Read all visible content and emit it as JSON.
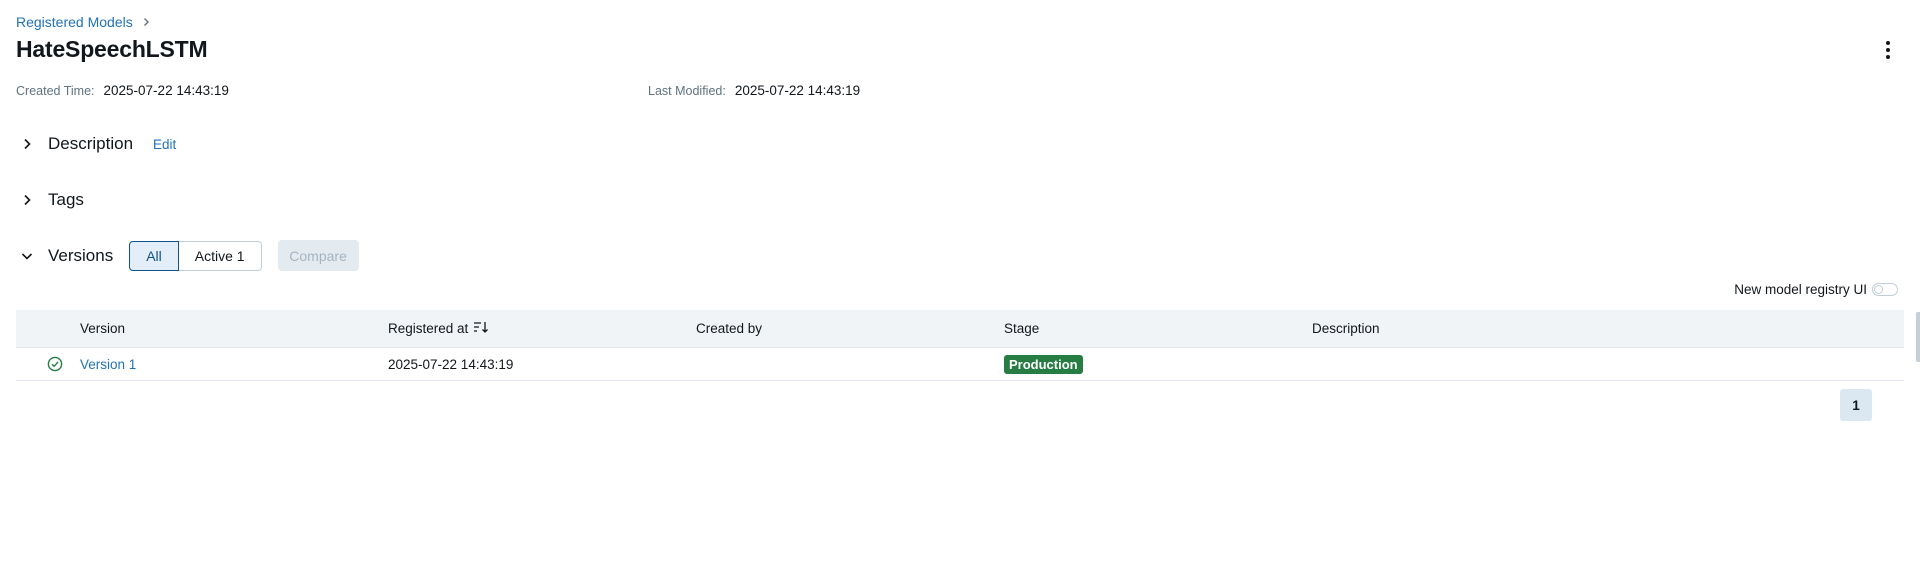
{
  "breadcrumb": {
    "parent_label": "Registered Models",
    "separator_icon": "chevron-right-icon"
  },
  "model": {
    "name": "HateSpeechLSTM"
  },
  "meta": {
    "created_label": "Created Time:",
    "created_value": "2025-07-22 14:43:19",
    "modified_label": "Last Modified:",
    "modified_value": "2025-07-22 14:43:19"
  },
  "sections": {
    "description": {
      "title": "Description",
      "edit_label": "Edit",
      "expanded": false
    },
    "tags": {
      "title": "Tags",
      "expanded": false
    },
    "versions": {
      "title": "Versions",
      "expanded": true,
      "filter_all": "All",
      "filter_active": "Active 1",
      "selected_filter": "All",
      "compare_label": "Compare"
    }
  },
  "toggle": {
    "label": "New model registry UI",
    "on": false
  },
  "table": {
    "columns": [
      "Version",
      "Registered at",
      "Created by",
      "Stage",
      "Description"
    ],
    "rows": [
      {
        "status_icon": "check-circle-icon",
        "version": "Version 1",
        "registered_at": "2025-07-22 14:43:19",
        "created_by": "",
        "stage": "Production",
        "description": ""
      }
    ]
  },
  "pagination": {
    "current_page": "1"
  },
  "colors": {
    "link": "#2272b4",
    "stage_production": "#277c43",
    "success_icon": "#277c43"
  }
}
